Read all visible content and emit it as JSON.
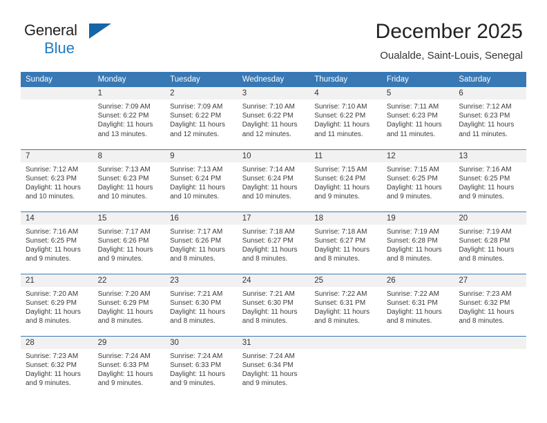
{
  "brand": {
    "line1": "General",
    "line2": "Blue",
    "triangle_color": "#1565a8"
  },
  "header": {
    "title": "December 2025",
    "subtitle": "Oualalde, Saint-Louis, Senegal"
  },
  "theme": {
    "header_blue": "#3878b4",
    "daynum_band": "#f1f1f1",
    "text": "#333333"
  },
  "weekday_headers": [
    "Sunday",
    "Monday",
    "Tuesday",
    "Wednesday",
    "Thursday",
    "Friday",
    "Saturday"
  ],
  "weeks": [
    [
      {
        "day": "",
        "sunrise": "",
        "sunset": "",
        "daylight_line1": "",
        "daylight_line2": ""
      },
      {
        "day": "1",
        "sunrise": "Sunrise: 7:09 AM",
        "sunset": "Sunset: 6:22 PM",
        "daylight_line1": "Daylight: 11 hours",
        "daylight_line2": "and 13 minutes."
      },
      {
        "day": "2",
        "sunrise": "Sunrise: 7:09 AM",
        "sunset": "Sunset: 6:22 PM",
        "daylight_line1": "Daylight: 11 hours",
        "daylight_line2": "and 12 minutes."
      },
      {
        "day": "3",
        "sunrise": "Sunrise: 7:10 AM",
        "sunset": "Sunset: 6:22 PM",
        "daylight_line1": "Daylight: 11 hours",
        "daylight_line2": "and 12 minutes."
      },
      {
        "day": "4",
        "sunrise": "Sunrise: 7:10 AM",
        "sunset": "Sunset: 6:22 PM",
        "daylight_line1": "Daylight: 11 hours",
        "daylight_line2": "and 11 minutes."
      },
      {
        "day": "5",
        "sunrise": "Sunrise: 7:11 AM",
        "sunset": "Sunset: 6:23 PM",
        "daylight_line1": "Daylight: 11 hours",
        "daylight_line2": "and 11 minutes."
      },
      {
        "day": "6",
        "sunrise": "Sunrise: 7:12 AM",
        "sunset": "Sunset: 6:23 PM",
        "daylight_line1": "Daylight: 11 hours",
        "daylight_line2": "and 11 minutes."
      }
    ],
    [
      {
        "day": "7",
        "sunrise": "Sunrise: 7:12 AM",
        "sunset": "Sunset: 6:23 PM",
        "daylight_line1": "Daylight: 11 hours",
        "daylight_line2": "and 10 minutes."
      },
      {
        "day": "8",
        "sunrise": "Sunrise: 7:13 AM",
        "sunset": "Sunset: 6:23 PM",
        "daylight_line1": "Daylight: 11 hours",
        "daylight_line2": "and 10 minutes."
      },
      {
        "day": "9",
        "sunrise": "Sunrise: 7:13 AM",
        "sunset": "Sunset: 6:24 PM",
        "daylight_line1": "Daylight: 11 hours",
        "daylight_line2": "and 10 minutes."
      },
      {
        "day": "10",
        "sunrise": "Sunrise: 7:14 AM",
        "sunset": "Sunset: 6:24 PM",
        "daylight_line1": "Daylight: 11 hours",
        "daylight_line2": "and 10 minutes."
      },
      {
        "day": "11",
        "sunrise": "Sunrise: 7:15 AM",
        "sunset": "Sunset: 6:24 PM",
        "daylight_line1": "Daylight: 11 hours",
        "daylight_line2": "and 9 minutes."
      },
      {
        "day": "12",
        "sunrise": "Sunrise: 7:15 AM",
        "sunset": "Sunset: 6:25 PM",
        "daylight_line1": "Daylight: 11 hours",
        "daylight_line2": "and 9 minutes."
      },
      {
        "day": "13",
        "sunrise": "Sunrise: 7:16 AM",
        "sunset": "Sunset: 6:25 PM",
        "daylight_line1": "Daylight: 11 hours",
        "daylight_line2": "and 9 minutes."
      }
    ],
    [
      {
        "day": "14",
        "sunrise": "Sunrise: 7:16 AM",
        "sunset": "Sunset: 6:25 PM",
        "daylight_line1": "Daylight: 11 hours",
        "daylight_line2": "and 9 minutes."
      },
      {
        "day": "15",
        "sunrise": "Sunrise: 7:17 AM",
        "sunset": "Sunset: 6:26 PM",
        "daylight_line1": "Daylight: 11 hours",
        "daylight_line2": "and 9 minutes."
      },
      {
        "day": "16",
        "sunrise": "Sunrise: 7:17 AM",
        "sunset": "Sunset: 6:26 PM",
        "daylight_line1": "Daylight: 11 hours",
        "daylight_line2": "and 8 minutes."
      },
      {
        "day": "17",
        "sunrise": "Sunrise: 7:18 AM",
        "sunset": "Sunset: 6:27 PM",
        "daylight_line1": "Daylight: 11 hours",
        "daylight_line2": "and 8 minutes."
      },
      {
        "day": "18",
        "sunrise": "Sunrise: 7:18 AM",
        "sunset": "Sunset: 6:27 PM",
        "daylight_line1": "Daylight: 11 hours",
        "daylight_line2": "and 8 minutes."
      },
      {
        "day": "19",
        "sunrise": "Sunrise: 7:19 AM",
        "sunset": "Sunset: 6:28 PM",
        "daylight_line1": "Daylight: 11 hours",
        "daylight_line2": "and 8 minutes."
      },
      {
        "day": "20",
        "sunrise": "Sunrise: 7:19 AM",
        "sunset": "Sunset: 6:28 PM",
        "daylight_line1": "Daylight: 11 hours",
        "daylight_line2": "and 8 minutes."
      }
    ],
    [
      {
        "day": "21",
        "sunrise": "Sunrise: 7:20 AM",
        "sunset": "Sunset: 6:29 PM",
        "daylight_line1": "Daylight: 11 hours",
        "daylight_line2": "and 8 minutes."
      },
      {
        "day": "22",
        "sunrise": "Sunrise: 7:20 AM",
        "sunset": "Sunset: 6:29 PM",
        "daylight_line1": "Daylight: 11 hours",
        "daylight_line2": "and 8 minutes."
      },
      {
        "day": "23",
        "sunrise": "Sunrise: 7:21 AM",
        "sunset": "Sunset: 6:30 PM",
        "daylight_line1": "Daylight: 11 hours",
        "daylight_line2": "and 8 minutes."
      },
      {
        "day": "24",
        "sunrise": "Sunrise: 7:21 AM",
        "sunset": "Sunset: 6:30 PM",
        "daylight_line1": "Daylight: 11 hours",
        "daylight_line2": "and 8 minutes."
      },
      {
        "day": "25",
        "sunrise": "Sunrise: 7:22 AM",
        "sunset": "Sunset: 6:31 PM",
        "daylight_line1": "Daylight: 11 hours",
        "daylight_line2": "and 8 minutes."
      },
      {
        "day": "26",
        "sunrise": "Sunrise: 7:22 AM",
        "sunset": "Sunset: 6:31 PM",
        "daylight_line1": "Daylight: 11 hours",
        "daylight_line2": "and 8 minutes."
      },
      {
        "day": "27",
        "sunrise": "Sunrise: 7:23 AM",
        "sunset": "Sunset: 6:32 PM",
        "daylight_line1": "Daylight: 11 hours",
        "daylight_line2": "and 8 minutes."
      }
    ],
    [
      {
        "day": "28",
        "sunrise": "Sunrise: 7:23 AM",
        "sunset": "Sunset: 6:32 PM",
        "daylight_line1": "Daylight: 11 hours",
        "daylight_line2": "and 9 minutes."
      },
      {
        "day": "29",
        "sunrise": "Sunrise: 7:24 AM",
        "sunset": "Sunset: 6:33 PM",
        "daylight_line1": "Daylight: 11 hours",
        "daylight_line2": "and 9 minutes."
      },
      {
        "day": "30",
        "sunrise": "Sunrise: 7:24 AM",
        "sunset": "Sunset: 6:33 PM",
        "daylight_line1": "Daylight: 11 hours",
        "daylight_line2": "and 9 minutes."
      },
      {
        "day": "31",
        "sunrise": "Sunrise: 7:24 AM",
        "sunset": "Sunset: 6:34 PM",
        "daylight_line1": "Daylight: 11 hours",
        "daylight_line2": "and 9 minutes."
      },
      {
        "day": "",
        "sunrise": "",
        "sunset": "",
        "daylight_line1": "",
        "daylight_line2": ""
      },
      {
        "day": "",
        "sunrise": "",
        "sunset": "",
        "daylight_line1": "",
        "daylight_line2": ""
      },
      {
        "day": "",
        "sunrise": "",
        "sunset": "",
        "daylight_line1": "",
        "daylight_line2": ""
      }
    ]
  ]
}
